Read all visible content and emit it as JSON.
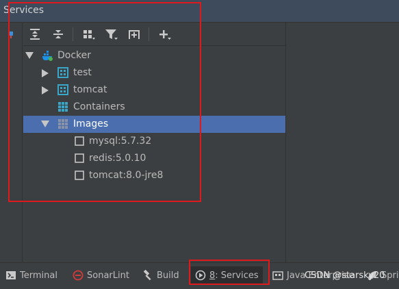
{
  "window": {
    "title": "Services"
  },
  "toolbar": {
    "buttons": [
      "expand-all",
      "collapse-all",
      "group-by",
      "filter",
      "add-service",
      "add"
    ]
  },
  "tree": {
    "root": {
      "label": "Docker",
      "expanded": true
    },
    "items": [
      {
        "label": "test",
        "kind": "container",
        "expanded": false
      },
      {
        "label": "tomcat",
        "kind": "container",
        "expanded": false
      },
      {
        "label": "Containers",
        "kind": "group"
      },
      {
        "label": "Images",
        "kind": "group",
        "expanded": true,
        "selected": true
      }
    ],
    "images": [
      {
        "label": "mysql:5.7.32"
      },
      {
        "label": "redis:5.0.10"
      },
      {
        "label": "tomcat:8.0-jre8"
      }
    ]
  },
  "statusbar": {
    "terminal": "Terminal",
    "sonarlint": "SonarLint",
    "build": "Build",
    "services_mnemonic": "8",
    "services_label": ": Services",
    "java_enterprise": "Java Enterprise",
    "spring": "Sprin"
  },
  "watermark": "CSDN @starsky20",
  "colors": {
    "selection": "#4b6eaf",
    "highlight": "#e0191d",
    "docker_blue": "#1d91e6",
    "node_teal": "#3aa7c9"
  }
}
